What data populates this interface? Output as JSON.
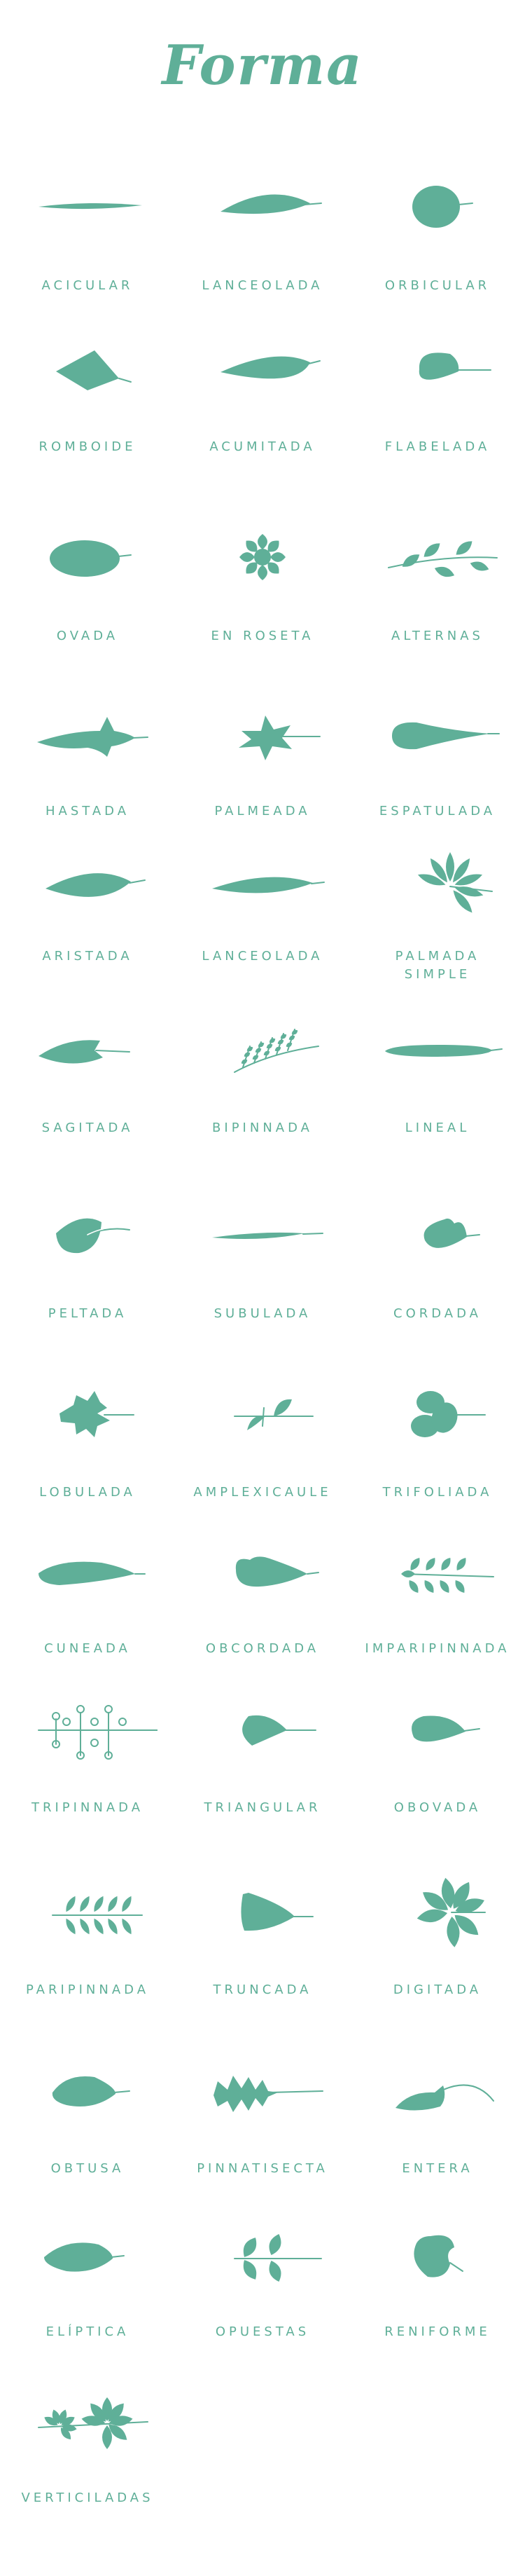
{
  "title": "Forma",
  "colors": {
    "accent": "#5faf98",
    "background": "#ffffff"
  },
  "leaves": [
    {
      "name": "ACICULAR"
    },
    {
      "name": "LANCEOLADA"
    },
    {
      "name": "ORBICULAR"
    },
    {
      "name": "ROMBOIDE"
    },
    {
      "name": "ACUMITADA"
    },
    {
      "name": "FLABELADA"
    },
    {
      "name": "OVADA"
    },
    {
      "name": "EN ROSETA"
    },
    {
      "name": "ALTERNAS"
    },
    {
      "name": "HASTADA"
    },
    {
      "name": "PALMEADA"
    },
    {
      "name": "ESPATULADA"
    },
    {
      "name": "ARISTADA"
    },
    {
      "name": "LANCEOLADA"
    },
    {
      "name": "PALMADA SIMPLE"
    },
    {
      "name": "SAGITADA"
    },
    {
      "name": "BIPINNADA"
    },
    {
      "name": "LINEAL"
    },
    {
      "name": "PELTADA"
    },
    {
      "name": "SUBULADA"
    },
    {
      "name": "CORDADA"
    },
    {
      "name": "LOBULADA"
    },
    {
      "name": "AMPLEXICAULE"
    },
    {
      "name": "TRIFOLIADA"
    },
    {
      "name": "CUNEADA"
    },
    {
      "name": "OBCORDADA"
    },
    {
      "name": "IMPARIPINNADA"
    },
    {
      "name": "TRIPINNADA"
    },
    {
      "name": "TRIANGULAR"
    },
    {
      "name": "OBOVADA"
    },
    {
      "name": "PARIPINNADA"
    },
    {
      "name": "TRUNCADA"
    },
    {
      "name": "DIGITADA"
    },
    {
      "name": "OBTUSA"
    },
    {
      "name": "PINNATISECTA"
    },
    {
      "name": "ENTERA"
    },
    {
      "name": "ELÍPTICA"
    },
    {
      "name": "OPUESTAS"
    },
    {
      "name": "RENIFORME"
    },
    {
      "name": "VERTICILADAS"
    }
  ]
}
